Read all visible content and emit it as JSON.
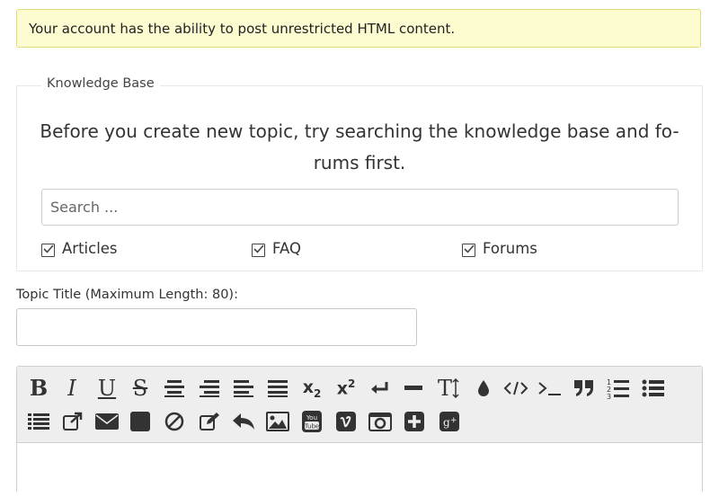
{
  "notice": {
    "text": "Your account has the ability to post unrestricted HTML content."
  },
  "knowledge_base": {
    "legend": "Knowledge Base",
    "intro_line1": "Before you create new topic, try searching the knowledge base and fo-",
    "intro_line2": "rums first.",
    "search_placeholder": "Search ...",
    "filters": [
      {
        "label": "Articles",
        "checked": true
      },
      {
        "label": "FAQ",
        "checked": true
      },
      {
        "label": "Forums",
        "checked": true
      }
    ]
  },
  "topic": {
    "label": "Topic Title (Maximum Length: 80):",
    "value": ""
  },
  "editor": {
    "toolbar_row1": [
      "bold",
      "italic",
      "underline",
      "strikethrough",
      "align-center",
      "align-right",
      "align-left",
      "align-justify",
      "subscript",
      "superscript",
      "line-break",
      "horizontal-rule",
      "font-size",
      "color",
      "code",
      "terminal",
      "quote",
      "ordered-list",
      "unordered-list"
    ],
    "toolbar_row2": [
      "list",
      "external-link",
      "email",
      "square",
      "no-parse",
      "edit",
      "reply",
      "image",
      "youtube",
      "vimeo",
      "camera",
      "plus",
      "google-plus"
    ],
    "glyphs": {
      "bold": "B",
      "italic": "I",
      "underline": "U",
      "strike": "S",
      "font_size": "T",
      "subscript": "x",
      "subscript_mark": "2",
      "superscript": "x",
      "superscript_mark": "2"
    }
  }
}
